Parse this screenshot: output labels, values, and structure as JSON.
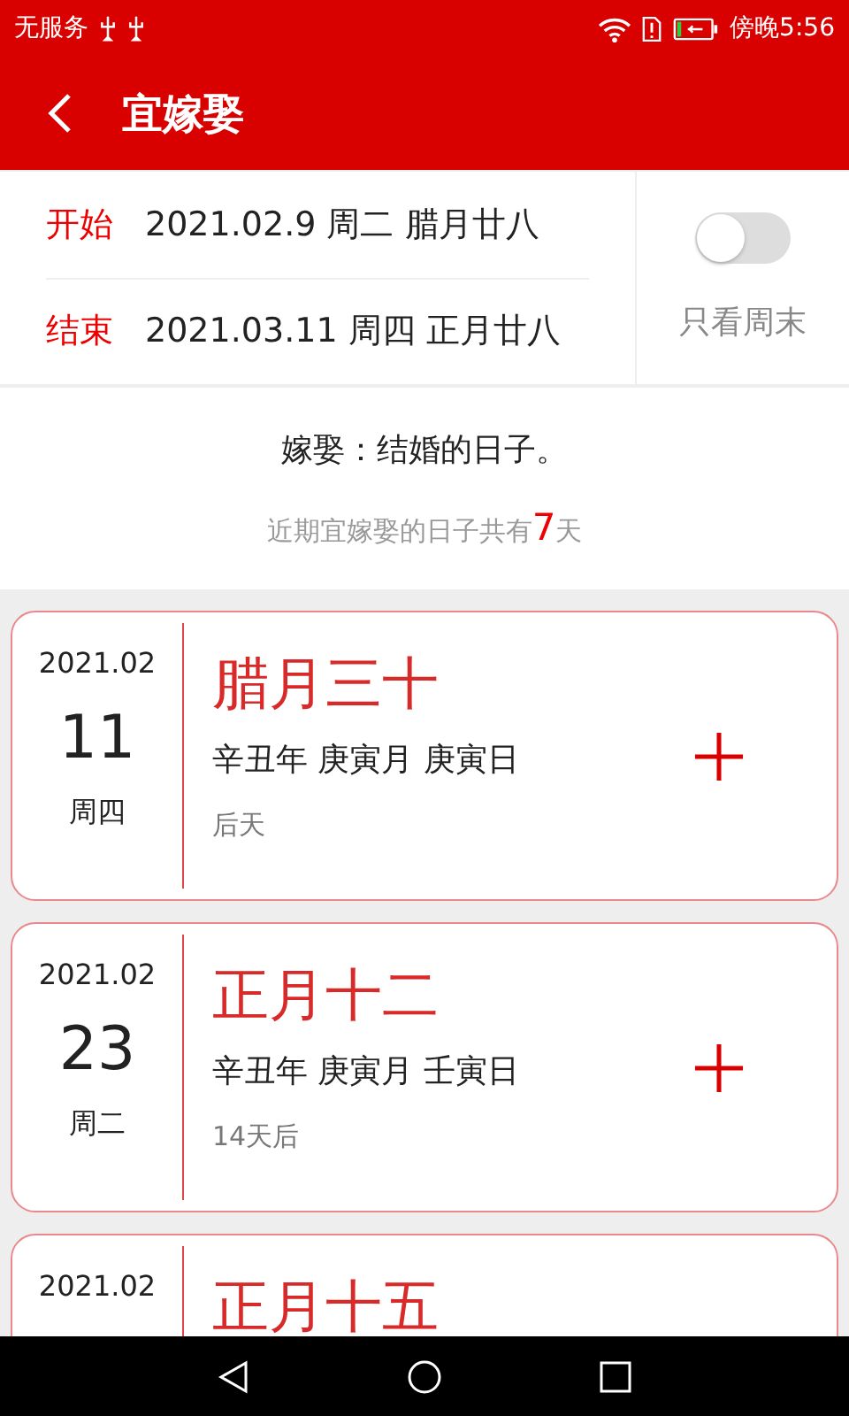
{
  "status_bar": {
    "carrier": "无服务",
    "time": "傍晚5:56"
  },
  "header": {
    "title": "宜嫁娶"
  },
  "range": [
    {
      "label": "开始",
      "value": "2021.02.9 周二 腊月廿八"
    },
    {
      "label": "结束",
      "value": "2021.03.11 周四 正月廿八"
    }
  ],
  "weekend_filter": {
    "label": "只看周末",
    "on": false
  },
  "description": "嫁娶：结婚的日子。",
  "summary": {
    "before": "近期宜嫁娶的日子共有",
    "count": "7",
    "after": "天"
  },
  "days": [
    {
      "month": "2021.02",
      "day": "11",
      "weekday": "周四",
      "lunar": "腊月三十",
      "ganzhi": "辛丑年 庚寅月 庚寅日",
      "relative": "后天"
    },
    {
      "month": "2021.02",
      "day": "23",
      "weekday": "周二",
      "lunar": "正月十二",
      "ganzhi": "辛丑年 庚寅月 壬寅日",
      "relative": "14天后"
    },
    {
      "month": "2021.02",
      "lunar": "正月十五"
    }
  ]
}
